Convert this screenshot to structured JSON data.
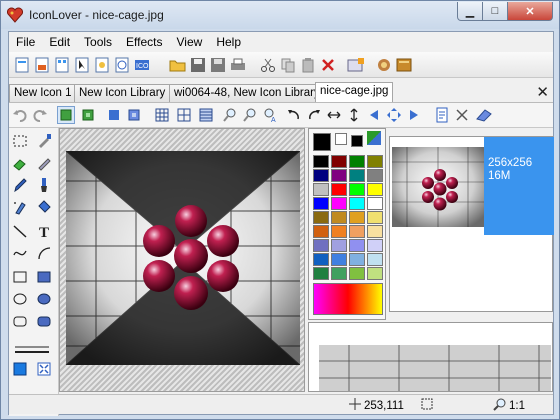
{
  "window": {
    "title": "IconLover - nice-cage.jpg"
  },
  "menu": [
    "File",
    "Edit",
    "Tools",
    "Effects",
    "View",
    "Help"
  ],
  "tabs": [
    "New Icon 1",
    "New Icon Library 1",
    "wi0064-48, New Icon Library 1",
    "nice-cage.jpg"
  ],
  "preview": {
    "size": "256x256",
    "colors": "16M"
  },
  "status": {
    "coords": "253,111",
    "zoom": "1:1"
  },
  "colors": {
    "accent": "#3a94ee",
    "palette": [
      [
        "#000000",
        "#800000",
        "#008000",
        "#808000"
      ],
      [
        "#000080",
        "#800080",
        "#008080",
        "#808080"
      ],
      [
        "#c0c0c0",
        "#ff0000",
        "#00ff00",
        "#ffff00"
      ],
      [
        "#0000ff",
        "#ff00ff",
        "#00ffff",
        "#ffffff"
      ],
      [
        "#8a6a10",
        "#c08a20",
        "#e0a020",
        "#f0e070"
      ],
      [
        "#d06010",
        "#f08020",
        "#f0a060",
        "#f8e0a0"
      ],
      [
        "#7070c0",
        "#a0a0e0",
        "#9090f0",
        "#d0d0f8"
      ],
      [
        "#1060c0",
        "#4080e0",
        "#80b0e0",
        "#c0e0f0"
      ],
      [
        "#208040",
        "#40a060",
        "#80c040",
        "#c0e080"
      ]
    ]
  }
}
